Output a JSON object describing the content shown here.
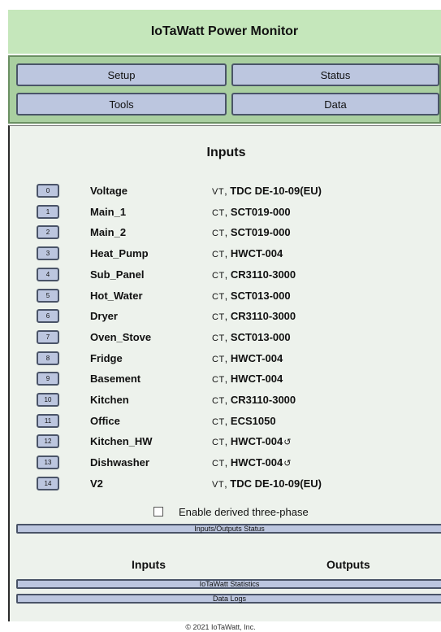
{
  "header": {
    "title": "IoTaWatt Power Monitor"
  },
  "menu": {
    "setup": "Setup",
    "status": "Status",
    "tools": "Tools",
    "data": "Data"
  },
  "inputs": {
    "title": "Inputs",
    "rows": [
      {
        "num": "0",
        "name": "Voltage",
        "type": "VT",
        "model": "TDC DE-10-09(EU)",
        "rev": ""
      },
      {
        "num": "1",
        "name": "Main_1",
        "type": "CT",
        "model": "SCT019-000",
        "rev": ""
      },
      {
        "num": "2",
        "name": "Main_2",
        "type": "CT",
        "model": "SCT019-000",
        "rev": ""
      },
      {
        "num": "3",
        "name": "Heat_Pump",
        "type": "CT",
        "model": "HWCT-004",
        "rev": ""
      },
      {
        "num": "4",
        "name": "Sub_Panel",
        "type": "CT",
        "model": "CR3110-3000",
        "rev": ""
      },
      {
        "num": "5",
        "name": "Hot_Water",
        "type": "CT",
        "model": "SCT013-000",
        "rev": ""
      },
      {
        "num": "6",
        "name": "Dryer",
        "type": "CT",
        "model": "CR3110-3000",
        "rev": ""
      },
      {
        "num": "7",
        "name": "Oven_Stove",
        "type": "CT",
        "model": "SCT013-000",
        "rev": ""
      },
      {
        "num": "8",
        "name": "Fridge",
        "type": "CT",
        "model": "HWCT-004",
        "rev": ""
      },
      {
        "num": "9",
        "name": "Basement",
        "type": "CT",
        "model": "HWCT-004",
        "rev": ""
      },
      {
        "num": "10",
        "name": "Kitchen",
        "type": "CT",
        "model": "CR3110-3000",
        "rev": ""
      },
      {
        "num": "11",
        "name": "Office",
        "type": "CT",
        "model": "ECS1050",
        "rev": ""
      },
      {
        "num": "12",
        "name": "Kitchen_HW",
        "type": "CT",
        "model": "HWCT-004",
        "rev": "↺"
      },
      {
        "num": "13",
        "name": "Dishwasher",
        "type": "CT",
        "model": "HWCT-004",
        "rev": "↺"
      },
      {
        "num": "14",
        "name": "V2",
        "type": "VT",
        "model": "TDC DE-10-09(EU)",
        "rev": ""
      }
    ]
  },
  "derived": {
    "label": "Enable derived three-phase",
    "checked": false
  },
  "buttons": {
    "io_status": "Inputs/Outputs Status",
    "stats": "IoTaWatt Statistics",
    "logs": "Data Logs"
  },
  "io_headers": {
    "inputs": "Inputs",
    "outputs": "Outputs"
  },
  "footer": {
    "copyright": "© 2021 IoTaWatt, Inc."
  }
}
